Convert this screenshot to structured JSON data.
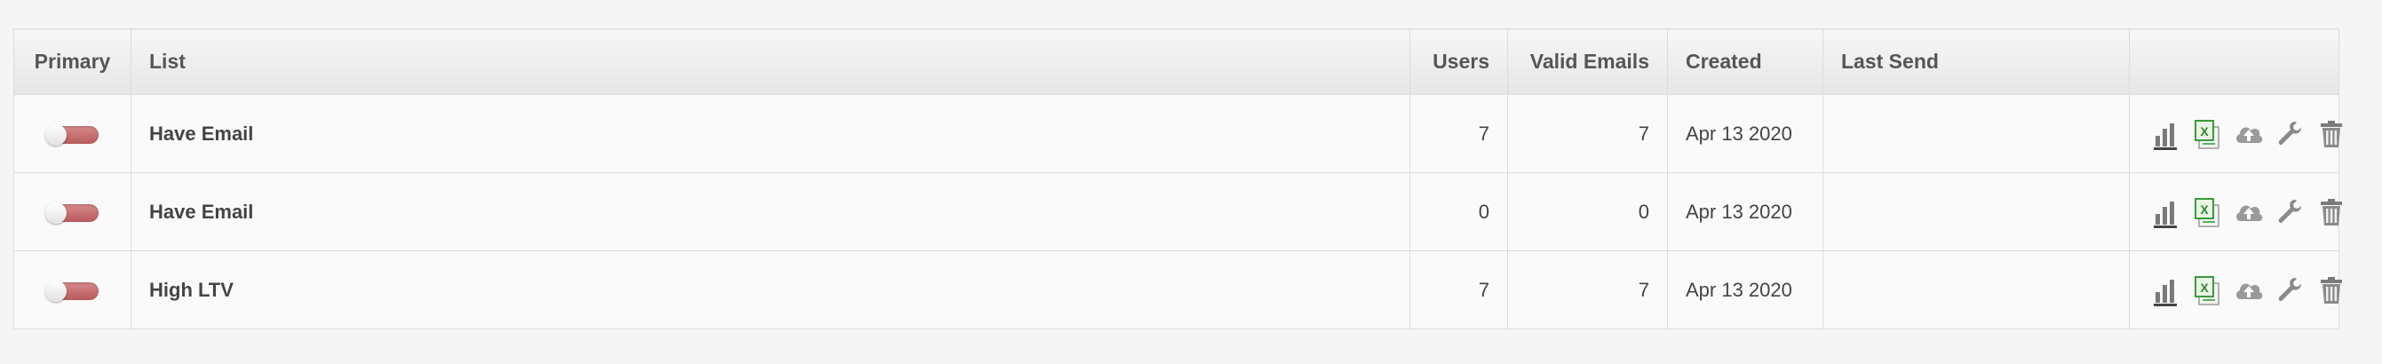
{
  "table": {
    "headers": {
      "primary": "Primary",
      "list": "List",
      "users": "Users",
      "valid_emails": "Valid Emails",
      "created": "Created",
      "last_send": "Last Send",
      "actions": ""
    },
    "rows": [
      {
        "primary": false,
        "list": "Have Email",
        "users": "7",
        "valid_emails": "7",
        "created": "Apr 13 2020",
        "last_send": ""
      },
      {
        "primary": false,
        "list": "Have Email",
        "users": "0",
        "valid_emails": "0",
        "created": "Apr 13 2020",
        "last_send": ""
      },
      {
        "primary": false,
        "list": "High LTV",
        "users": "7",
        "valid_emails": "7",
        "created": "Apr 13 2020",
        "last_send": ""
      }
    ],
    "row_actions": [
      "bar-chart-icon",
      "excel-export-icon",
      "cloud-upload-icon",
      "wrench-icon",
      "trash-icon"
    ],
    "colors": {
      "toggle_off": "#c06464",
      "excel_green": "#3a9b3a",
      "icon_gray": "#8a8a8a"
    }
  }
}
